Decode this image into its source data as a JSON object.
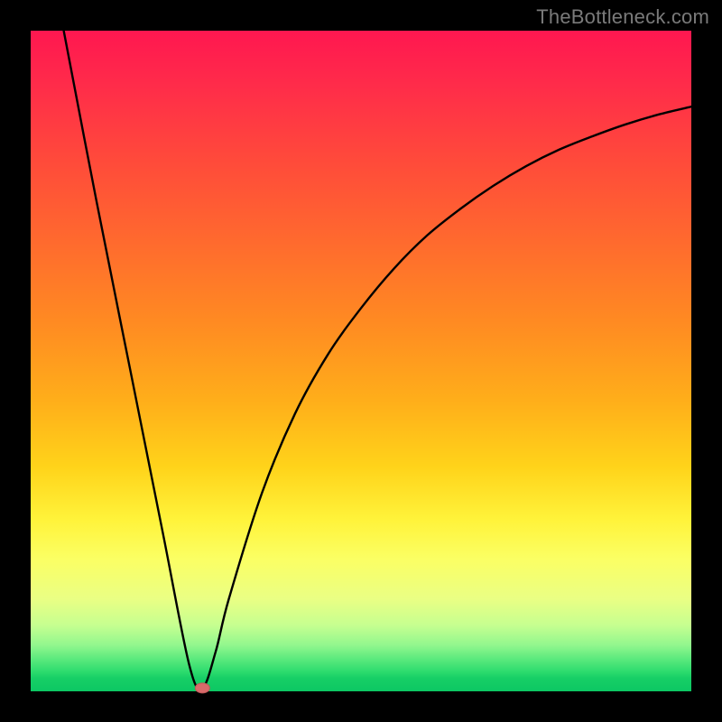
{
  "watermark": "TheBottleneck.com",
  "colors": {
    "frame": "#000000",
    "curve": "#000000",
    "marker_fill": "#d86a6a",
    "marker_stroke": "#c05858"
  },
  "chart_data": {
    "type": "line",
    "title": "",
    "xlabel": "",
    "ylabel": "",
    "xlim": [
      0,
      100
    ],
    "ylim": [
      0,
      100
    ],
    "grid": false,
    "legend": false,
    "series": [
      {
        "name": "bottleneck-curve",
        "x": [
          5,
          10,
          15,
          20,
          24,
          26,
          28,
          30,
          35,
          40,
          45,
          50,
          55,
          60,
          65,
          70,
          75,
          80,
          85,
          90,
          95,
          100
        ],
        "y": [
          100,
          74,
          49,
          24,
          4,
          0.5,
          6,
          14,
          30,
          42,
          51,
          58,
          64,
          69,
          73,
          76.5,
          79.5,
          82,
          84,
          85.8,
          87.3,
          88.5
        ]
      }
    ],
    "markers": [
      {
        "name": "optimum-marker",
        "x": 26,
        "y": 0.5
      }
    ],
    "annotations": []
  }
}
